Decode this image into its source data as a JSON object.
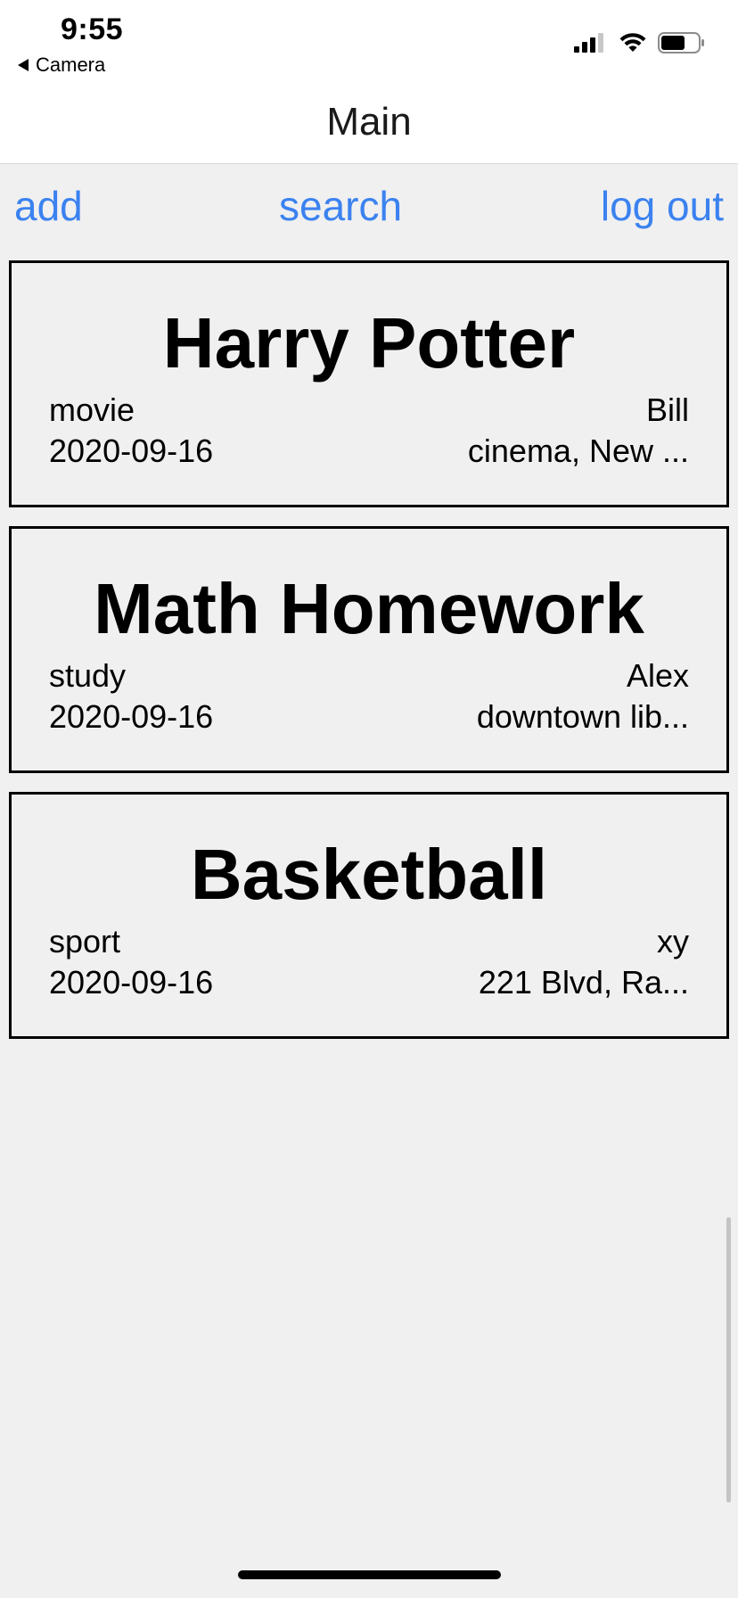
{
  "status_bar": {
    "time": "9:55",
    "back_app": "Camera",
    "icons": [
      "signal-icon",
      "wifi-icon",
      "battery-icon"
    ]
  },
  "nav": {
    "title": "Main"
  },
  "toolbar": {
    "add_label": "add",
    "search_label": "search",
    "logout_label": "log out"
  },
  "colors": {
    "accent": "#3b82f0",
    "background": "#f0f0f0",
    "card_border": "#000000"
  },
  "cards": [
    {
      "title": "Harry Potter",
      "category": "movie",
      "date": "2020-09-16",
      "person": "Bill",
      "location": "cinema, New ..."
    },
    {
      "title": "Math Homework",
      "category": "study",
      "date": "2020-09-16",
      "person": "Alex",
      "location": "downtown lib..."
    },
    {
      "title": "Basketball",
      "category": "sport",
      "date": "2020-09-16",
      "person": "xy",
      "location": "221 Blvd, Ra..."
    }
  ]
}
